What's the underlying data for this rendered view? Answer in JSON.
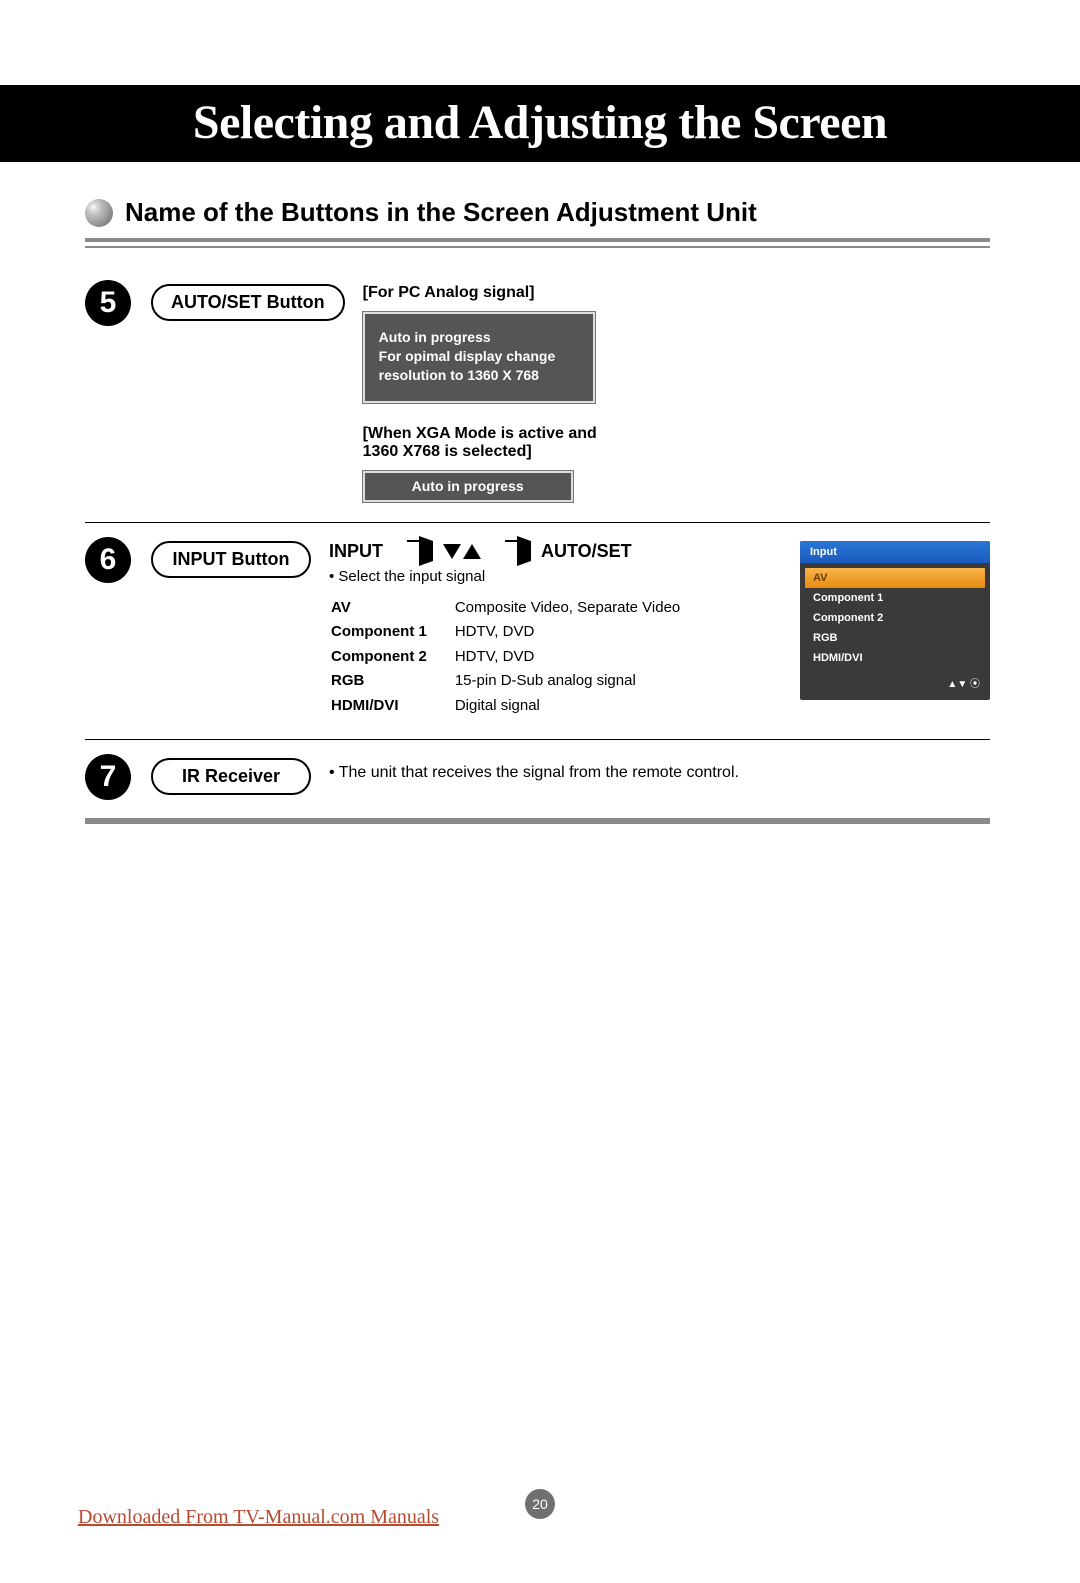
{
  "title": "Selecting and Adjusting the Screen",
  "section_heading": "Name of the Buttons in the Screen Adjustment Unit",
  "item5": {
    "num": "5",
    "pill": "AUTO/SET Button",
    "sub1": "[For PC Analog signal]",
    "osd1_l1": "Auto in progress",
    "osd1_l2": "For opimal display change",
    "osd1_l3": "resolution to 1360 X 768",
    "sub2_l1": "[When XGA Mode is active and",
    "sub2_l2": " 1360 X768 is selected]",
    "osd2": "Auto in progress"
  },
  "item6": {
    "num": "6",
    "pill": "INPUT Button",
    "flow_a": "INPUT",
    "flow_b": "AUTO/SET",
    "bullet": "• Select the input signal",
    "rows": [
      {
        "k": "AV",
        "v": "Composite Video, Separate Video"
      },
      {
        "k": "Component 1",
        "v": "HDTV, DVD"
      },
      {
        "k": "Component 2",
        "v": "HDTV, DVD"
      },
      {
        "k": "RGB",
        "v": "15-pin D-Sub analog signal"
      },
      {
        "k": "HDMI/DVI",
        "v": "Digital signal"
      }
    ],
    "osd": {
      "title": "Input",
      "items": [
        "AV",
        "Component 1",
        "Component 2",
        "RGB",
        "HDMI/DVI"
      ],
      "selected": 0
    }
  },
  "item7": {
    "num": "7",
    "pill": "IR Receiver",
    "text": "• The unit that receives the signal from the remote control."
  },
  "page_number": "20",
  "footer_link": "Downloaded From TV-Manual.com Manuals"
}
